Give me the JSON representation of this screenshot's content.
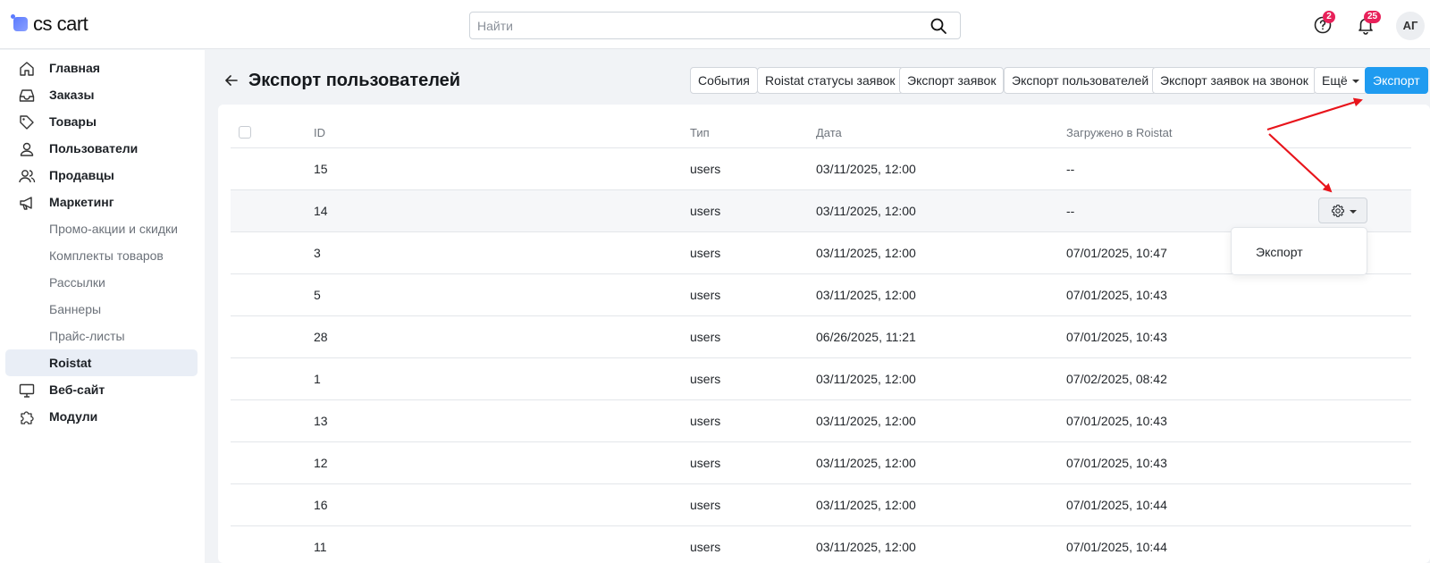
{
  "app": {
    "logo_text": "cs cart",
    "brand_color": "#1f9bf0"
  },
  "header": {
    "search_placeholder": "Найти",
    "help_badge": "2",
    "notifications_badge": "25",
    "avatar_initials": "АГ"
  },
  "sidebar": {
    "items": [
      {
        "label": "Главная",
        "icon": "home-icon"
      },
      {
        "label": "Заказы",
        "icon": "inbox-icon"
      },
      {
        "label": "Товары",
        "icon": "tag-icon"
      },
      {
        "label": "Пользователи",
        "icon": "user-icon"
      },
      {
        "label": "Продавцы",
        "icon": "users-icon"
      },
      {
        "label": "Маркетинг",
        "icon": "megaphone-icon"
      },
      {
        "label": "Промо-акции и скидки"
      },
      {
        "label": "Комплекты товаров"
      },
      {
        "label": "Рассылки"
      },
      {
        "label": "Баннеры"
      },
      {
        "label": "Прайс-листы"
      },
      {
        "label": "Roistat",
        "active": true
      },
      {
        "label": "Веб-сайт",
        "icon": "monitor-icon"
      },
      {
        "label": "Модули",
        "icon": "puzzle-icon"
      }
    ]
  },
  "page": {
    "title": "Экспорт пользователей",
    "toolbar": {
      "events": "События",
      "roistat_statuses": "Roistat статусы заявок",
      "export_orders": "Экспорт заявок",
      "export_users": "Экспорт пользователей",
      "export_callback": "Экспорт заявок на звонок",
      "more": "Ещё",
      "export": "Экспорт"
    }
  },
  "table": {
    "columns": {
      "id": "ID",
      "type": "Тип",
      "date": "Дата",
      "uploaded": "Загружено в Roistat"
    },
    "rows": [
      {
        "id": "15",
        "type": "users",
        "date": "03/11/2025, 12:00",
        "uploaded": "--"
      },
      {
        "id": "14",
        "type": "users",
        "date": "03/11/2025, 12:00",
        "uploaded": "--"
      },
      {
        "id": "3",
        "type": "users",
        "date": "03/11/2025, 12:00",
        "uploaded": "07/01/2025, 10:47"
      },
      {
        "id": "5",
        "type": "users",
        "date": "03/11/2025, 12:00",
        "uploaded": "07/01/2025, 10:43"
      },
      {
        "id": "28",
        "type": "users",
        "date": "06/26/2025, 11:21",
        "uploaded": "07/01/2025, 10:43"
      },
      {
        "id": "1",
        "type": "users",
        "date": "03/11/2025, 12:00",
        "uploaded": "07/02/2025, 08:42"
      },
      {
        "id": "13",
        "type": "users",
        "date": "03/11/2025, 12:00",
        "uploaded": "07/01/2025, 10:43"
      },
      {
        "id": "12",
        "type": "users",
        "date": "03/11/2025, 12:00",
        "uploaded": "07/01/2025, 10:43"
      },
      {
        "id": "16",
        "type": "users",
        "date": "03/11/2025, 12:00",
        "uploaded": "07/01/2025, 10:44"
      },
      {
        "id": "11",
        "type": "users",
        "date": "03/11/2025, 12:00",
        "uploaded": "07/01/2025, 10:44"
      }
    ],
    "row_actions": {
      "icon": "gear-icon",
      "dropdown_item": "Экспорт"
    }
  },
  "annotation": {
    "arrow_color": "#e8141b"
  }
}
